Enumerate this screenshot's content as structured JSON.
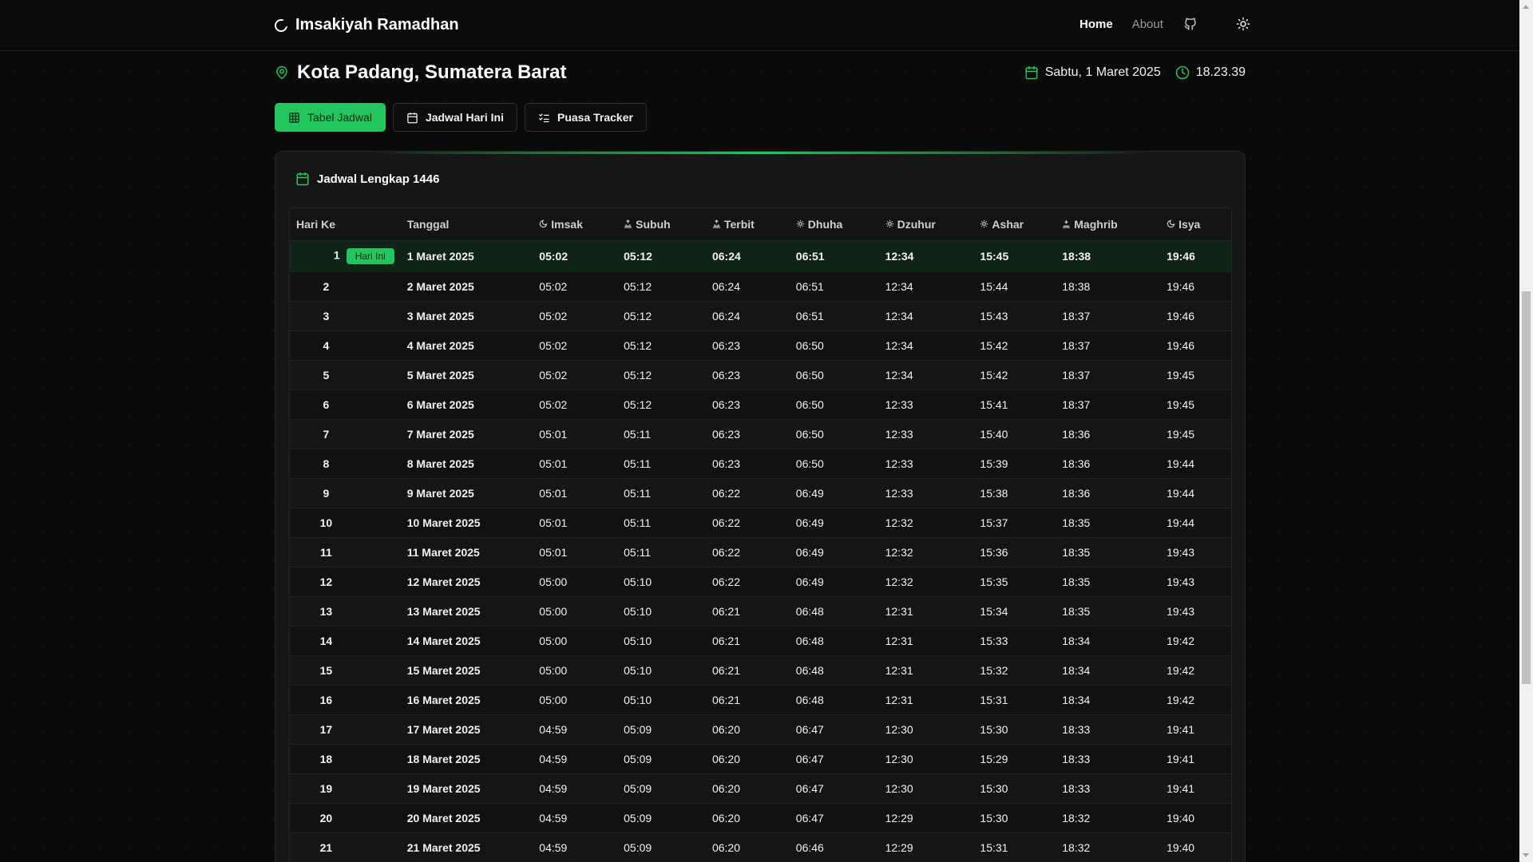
{
  "header": {
    "title": "Imsakiyah Ramadhan",
    "nav_home": "Home",
    "nav_about": "About"
  },
  "location": {
    "name": "Kota Padang, Sumatera Barat",
    "date": "Sabtu, 1 Maret 2025",
    "time": "18.23.39"
  },
  "tabs": [
    {
      "label": "Tabel Jadwal",
      "icon": "table-icon",
      "active": true
    },
    {
      "label": "Jadwal Hari Ini",
      "icon": "calendar-icon",
      "active": false
    },
    {
      "label": "Puasa Tracker",
      "icon": "list-checks-icon",
      "active": false
    }
  ],
  "card": {
    "title": "Jadwal Lengkap 1446"
  },
  "table": {
    "columns": [
      "Hari Ke",
      "Tanggal",
      "Imsak",
      "Subuh",
      "Terbit",
      "Dhuha",
      "Dzuhur",
      "Ashar",
      "Maghrib",
      "Isya"
    ],
    "today_badge": "Hari Ini",
    "rows": [
      [
        "1",
        "1 Maret 2025",
        "05:02",
        "05:12",
        "06:24",
        "06:51",
        "12:34",
        "15:45",
        "18:38",
        "19:46"
      ],
      [
        "2",
        "2 Maret 2025",
        "05:02",
        "05:12",
        "06:24",
        "06:51",
        "12:34",
        "15:44",
        "18:38",
        "19:46"
      ],
      [
        "3",
        "3 Maret 2025",
        "05:02",
        "05:12",
        "06:24",
        "06:51",
        "12:34",
        "15:43",
        "18:37",
        "19:46"
      ],
      [
        "4",
        "4 Maret 2025",
        "05:02",
        "05:12",
        "06:23",
        "06:50",
        "12:34",
        "15:42",
        "18:37",
        "19:46"
      ],
      [
        "5",
        "5 Maret 2025",
        "05:02",
        "05:12",
        "06:23",
        "06:50",
        "12:34",
        "15:42",
        "18:37",
        "19:45"
      ],
      [
        "6",
        "6 Maret 2025",
        "05:02",
        "05:12",
        "06:23",
        "06:50",
        "12:33",
        "15:41",
        "18:37",
        "19:45"
      ],
      [
        "7",
        "7 Maret 2025",
        "05:01",
        "05:11",
        "06:23",
        "06:50",
        "12:33",
        "15:40",
        "18:36",
        "19:45"
      ],
      [
        "8",
        "8 Maret 2025",
        "05:01",
        "05:11",
        "06:23",
        "06:50",
        "12:33",
        "15:39",
        "18:36",
        "19:44"
      ],
      [
        "9",
        "9 Maret 2025",
        "05:01",
        "05:11",
        "06:22",
        "06:49",
        "12:33",
        "15:38",
        "18:36",
        "19:44"
      ],
      [
        "10",
        "10 Maret 2025",
        "05:01",
        "05:11",
        "06:22",
        "06:49",
        "12:32",
        "15:37",
        "18:35",
        "19:44"
      ],
      [
        "11",
        "11 Maret 2025",
        "05:01",
        "05:11",
        "06:22",
        "06:49",
        "12:32",
        "15:36",
        "18:35",
        "19:43"
      ],
      [
        "12",
        "12 Maret 2025",
        "05:00",
        "05:10",
        "06:22",
        "06:49",
        "12:32",
        "15:35",
        "18:35",
        "19:43"
      ],
      [
        "13",
        "13 Maret 2025",
        "05:00",
        "05:10",
        "06:21",
        "06:48",
        "12:31",
        "15:34",
        "18:35",
        "19:43"
      ],
      [
        "14",
        "14 Maret 2025",
        "05:00",
        "05:10",
        "06:21",
        "06:48",
        "12:31",
        "15:33",
        "18:34",
        "19:42"
      ],
      [
        "15",
        "15 Maret 2025",
        "05:00",
        "05:10",
        "06:21",
        "06:48",
        "12:31",
        "15:32",
        "18:34",
        "19:42"
      ],
      [
        "16",
        "16 Maret 2025",
        "05:00",
        "05:10",
        "06:21",
        "06:48",
        "12:31",
        "15:31",
        "18:34",
        "19:42"
      ],
      [
        "17",
        "17 Maret 2025",
        "04:59",
        "05:09",
        "06:20",
        "06:47",
        "12:30",
        "15:30",
        "18:33",
        "19:41"
      ],
      [
        "18",
        "18 Maret 2025",
        "04:59",
        "05:09",
        "06:20",
        "06:47",
        "12:30",
        "15:29",
        "18:33",
        "19:41"
      ],
      [
        "19",
        "19 Maret 2025",
        "04:59",
        "05:09",
        "06:20",
        "06:47",
        "12:30",
        "15:30",
        "18:33",
        "19:41"
      ],
      [
        "20",
        "20 Maret 2025",
        "04:59",
        "05:09",
        "06:20",
        "06:47",
        "12:29",
        "15:30",
        "18:32",
        "19:40"
      ],
      [
        "21",
        "21 Maret 2025",
        "04:59",
        "05:09",
        "06:20",
        "06:46",
        "12:29",
        "15:31",
        "18:32",
        "19:40"
      ]
    ]
  },
  "colors": {
    "accent": "#22c55e",
    "background": "#0a0a0a",
    "card": "#161616"
  }
}
